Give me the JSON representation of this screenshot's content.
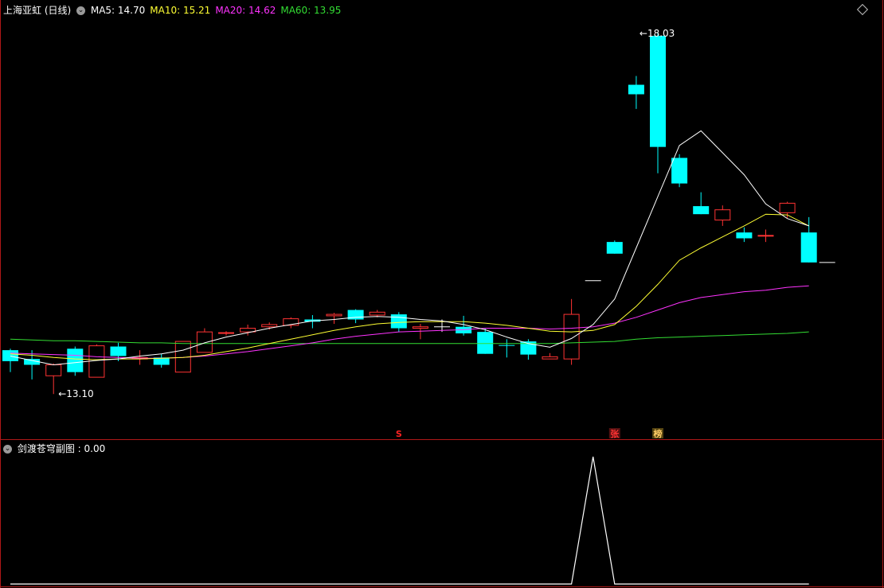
{
  "main_panel": {
    "title": "上海亚虹 (日线)",
    "ma_labels": [
      {
        "text": "MA5: 14.70",
        "color": "#ffffff"
      },
      {
        "text": "MA10: 15.21",
        "color": "#ffff33"
      },
      {
        "text": "MA20: 14.62",
        "color": "#ff33ff"
      },
      {
        "text": "MA60: 13.95",
        "color": "#33dd33"
      }
    ],
    "high_label": "18.03",
    "low_label": "13.10",
    "markers": [
      {
        "text": "S",
        "index": 18,
        "color": "#ff2222",
        "bg": ""
      },
      {
        "text": "张",
        "index": 28,
        "color": "#ff3333",
        "bg": "#551111"
      },
      {
        "text": "榜",
        "index": 30,
        "color": "#ffcc66",
        "bg": "#554411"
      }
    ]
  },
  "sub_panel": {
    "title": "剑渡苍穹副图",
    "value": ": 0.00"
  },
  "chart_data": {
    "type": "candlestick",
    "price_range": [
      12.7,
      18.25
    ],
    "candles": [
      {
        "o": 13.7,
        "h": 13.72,
        "l": 13.4,
        "c": 13.55
      },
      {
        "o": 13.58,
        "h": 13.7,
        "l": 13.3,
        "c": 13.5
      },
      {
        "o": 13.35,
        "h": 13.52,
        "l": 13.1,
        "c": 13.5
      },
      {
        "o": 13.72,
        "h": 13.75,
        "l": 13.35,
        "c": 13.4
      },
      {
        "o": 13.33,
        "h": 13.78,
        "l": 13.33,
        "c": 13.76
      },
      {
        "o": 13.75,
        "h": 13.8,
        "l": 13.55,
        "c": 13.62
      },
      {
        "o": 13.58,
        "h": 13.7,
        "l": 13.5,
        "c": 13.6
      },
      {
        "o": 13.6,
        "h": 13.65,
        "l": 13.46,
        "c": 13.5
      },
      {
        "o": 13.4,
        "h": 13.82,
        "l": 13.4,
        "c": 13.82
      },
      {
        "o": 13.67,
        "h": 14.0,
        "l": 13.67,
        "c": 13.95
      },
      {
        "o": 13.93,
        "h": 13.96,
        "l": 13.9,
        "c": 13.94
      },
      {
        "o": 13.95,
        "h": 14.05,
        "l": 13.9,
        "c": 14.0
      },
      {
        "o": 14.02,
        "h": 14.08,
        "l": 13.98,
        "c": 14.05
      },
      {
        "o": 14.04,
        "h": 14.15,
        "l": 14.0,
        "c": 14.13
      },
      {
        "o": 14.12,
        "h": 14.18,
        "l": 14.0,
        "c": 14.09
      },
      {
        "o": 14.17,
        "h": 14.21,
        "l": 14.06,
        "c": 14.19
      },
      {
        "o": 14.25,
        "h": 14.26,
        "l": 14.07,
        "c": 14.12
      },
      {
        "o": 14.18,
        "h": 14.25,
        "l": 14.15,
        "c": 14.22
      },
      {
        "o": 14.19,
        "h": 14.22,
        "l": 13.95,
        "c": 14.0
      },
      {
        "o": 14.0,
        "h": 14.06,
        "l": 13.85,
        "c": 14.02
      },
      {
        "o": 14.02,
        "h": 14.12,
        "l": 13.95,
        "c": 14.02
      },
      {
        "o": 14.02,
        "h": 14.17,
        "l": 13.9,
        "c": 13.93
      },
      {
        "o": 13.95,
        "h": 14.0,
        "l": 13.65,
        "c": 13.65
      },
      {
        "o": 13.77,
        "h": 13.85,
        "l": 13.6,
        "c": 13.76
      },
      {
        "o": 13.82,
        "h": 13.85,
        "l": 13.57,
        "c": 13.64
      },
      {
        "o": 13.58,
        "h": 13.66,
        "l": 13.58,
        "c": 13.61
      },
      {
        "o": 13.58,
        "h": 14.4,
        "l": 13.5,
        "c": 14.19
      },
      {
        "o": 14.65,
        "h": 14.65,
        "l": 14.65,
        "c": 14.65
      },
      {
        "o": 15.18,
        "h": 15.2,
        "l": 15.02,
        "c": 15.02
      },
      {
        "o": 17.33,
        "h": 17.45,
        "l": 17.0,
        "c": 17.2
      },
      {
        "o": 18.0,
        "h": 18.05,
        "l": 16.12,
        "c": 16.48
      },
      {
        "o": 16.33,
        "h": 16.38,
        "l": 15.93,
        "c": 15.98
      },
      {
        "o": 15.67,
        "h": 15.86,
        "l": 15.56,
        "c": 15.56
      },
      {
        "o": 15.48,
        "h": 15.68,
        "l": 15.4,
        "c": 15.62
      },
      {
        "o": 15.31,
        "h": 15.38,
        "l": 15.18,
        "c": 15.23
      },
      {
        "o": 15.26,
        "h": 15.35,
        "l": 15.18,
        "c": 15.27
      },
      {
        "o": 15.58,
        "h": 15.73,
        "l": 15.51,
        "c": 15.71
      },
      {
        "o": 15.31,
        "h": 15.52,
        "l": 14.9,
        "c": 14.9
      }
    ],
    "ma5": [
      13.62,
      13.56,
      13.5,
      13.53,
      13.56,
      13.58,
      13.62,
      13.65,
      13.7,
      13.8,
      13.88,
      13.94,
      14.0,
      14.05,
      14.1,
      14.12,
      14.15,
      14.16,
      14.15,
      14.12,
      14.1,
      14.05,
      13.98,
      13.88,
      13.79,
      13.74,
      13.86,
      14.05,
      14.4,
      15.1,
      15.8,
      16.5,
      16.7,
      16.4,
      16.1,
      15.7,
      15.5,
      15.4
    ],
    "ma10": [
      13.65,
      13.63,
      13.6,
      13.58,
      13.57,
      13.58,
      13.58,
      13.59,
      13.6,
      13.63,
      13.68,
      13.73,
      13.79,
      13.85,
      13.91,
      13.97,
      14.02,
      14.06,
      14.08,
      14.09,
      14.09,
      14.09,
      14.07,
      14.04,
      14.0,
      13.96,
      13.95,
      13.97,
      14.05,
      14.3,
      14.6,
      14.93,
      15.1,
      15.25,
      15.4,
      15.56,
      15.55,
      15.4
    ],
    "ma20": [
      13.66,
      13.65,
      13.64,
      13.63,
      13.61,
      13.6,
      13.59,
      13.59,
      13.6,
      13.62,
      13.65,
      13.68,
      13.72,
      13.76,
      13.8,
      13.85,
      13.89,
      13.92,
      13.95,
      13.96,
      13.97,
      13.98,
      14.0,
      14.0,
      14.0,
      13.99,
      14.0,
      14.02,
      14.07,
      14.15,
      14.25,
      14.35,
      14.42,
      14.46,
      14.5,
      14.52,
      14.56,
      14.58
    ],
    "ma60": [
      13.85,
      13.84,
      13.83,
      13.83,
      13.82,
      13.81,
      13.8,
      13.8,
      13.79,
      13.79,
      13.79,
      13.79,
      13.79,
      13.79,
      13.79,
      13.79,
      13.79,
      13.79,
      13.79,
      13.79,
      13.79,
      13.79,
      13.79,
      13.79,
      13.79,
      13.79,
      13.8,
      13.81,
      13.82,
      13.85,
      13.87,
      13.88,
      13.89,
      13.9,
      13.91,
      13.92,
      13.93,
      13.95
    ],
    "sub_indicator": {
      "values": [
        0,
        0,
        0,
        0,
        0,
        0,
        0,
        0,
        0,
        0,
        0,
        0,
        0,
        0,
        0,
        0,
        0,
        0,
        0,
        0,
        0,
        0,
        0,
        0,
        0,
        0,
        0,
        1,
        0,
        0,
        0,
        0,
        0,
        0,
        0,
        0,
        0,
        0
      ],
      "range": [
        0,
        1
      ]
    }
  }
}
